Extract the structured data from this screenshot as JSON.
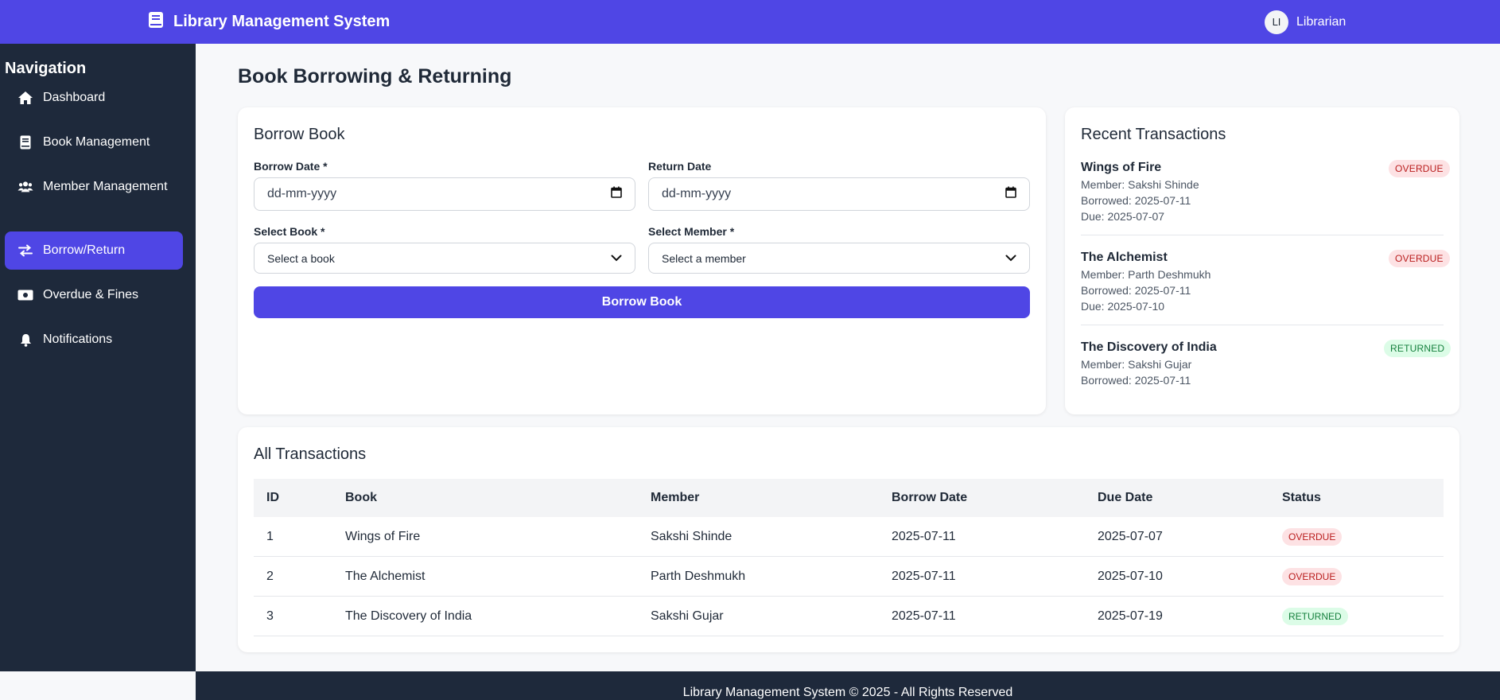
{
  "header": {
    "title": "Library Management System",
    "brand_icon": "book-icon",
    "user_initials": "LI",
    "user_name": "Librarian"
  },
  "sidebar": {
    "heading": "Navigation",
    "items": [
      {
        "label": "Dashboard",
        "icon": "home-icon"
      },
      {
        "label": "Book Management",
        "icon": "book-icon"
      },
      {
        "label": "Member Management",
        "icon": "users-icon"
      },
      {
        "label": "Borrow/Return",
        "icon": "exchange-icon",
        "active": true
      },
      {
        "label": "Overdue & Fines",
        "icon": "money-icon"
      },
      {
        "label": "Notifications",
        "icon": "bell-icon"
      }
    ]
  },
  "main": {
    "page_title": "Book Borrowing & Returning",
    "borrow": {
      "title": "Borrow Book",
      "borrow_date_label": "Borrow Date *",
      "borrow_date_value": "dd-mm-yyyy",
      "return_date_label": "Return Date",
      "return_date_value": "dd-mm-yyyy",
      "book_label": "Select Book *",
      "book_value": "Select a book",
      "member_label": "Select Member *",
      "member_value": "Select a member",
      "submit_label": "Borrow Book"
    },
    "recent": {
      "title": "Recent Transactions",
      "items": [
        {
          "book": "Wings of Fire",
          "member": "Member: Sakshi Shinde",
          "borrowed": "Borrowed: 2025-07-11",
          "due": "Due: 2025-07-07",
          "status": "OVERDUE"
        },
        {
          "book": "The Alchemist",
          "member": "Member: Parth Deshmukh",
          "borrowed": "Borrowed: 2025-07-11",
          "due": "Due: 2025-07-10",
          "status": "OVERDUE"
        },
        {
          "book": "The Discovery of India",
          "member": "Member: Sakshi Gujar",
          "borrowed": "Borrowed: 2025-07-11",
          "status": "RETURNED"
        }
      ]
    },
    "all": {
      "title": "All Transactions",
      "columns": [
        "ID",
        "Book",
        "Member",
        "Borrow Date",
        "Due Date",
        "Status"
      ],
      "rows": [
        [
          "1",
          "Wings of Fire",
          "Sakshi Shinde",
          "2025-07-11",
          "2025-07-07",
          "OVERDUE"
        ],
        [
          "2",
          "The Alchemist",
          "Parth Deshmukh",
          "2025-07-11",
          "2025-07-10",
          "OVERDUE"
        ],
        [
          "3",
          "The Discovery of India",
          "Sakshi Gujar",
          "2025-07-11",
          "2025-07-19",
          "RETURNED"
        ]
      ]
    }
  },
  "footer": {
    "text": "Library Management System © 2025 - All Rights Reserved"
  },
  "colors": {
    "primary": "#4f46e5",
    "sidebar_bg": "#1e293b",
    "overdue_bg": "#fde2e4",
    "overdue_text": "#b91c1c",
    "returned_bg": "#dcfce7",
    "returned_text": "#15803d"
  }
}
